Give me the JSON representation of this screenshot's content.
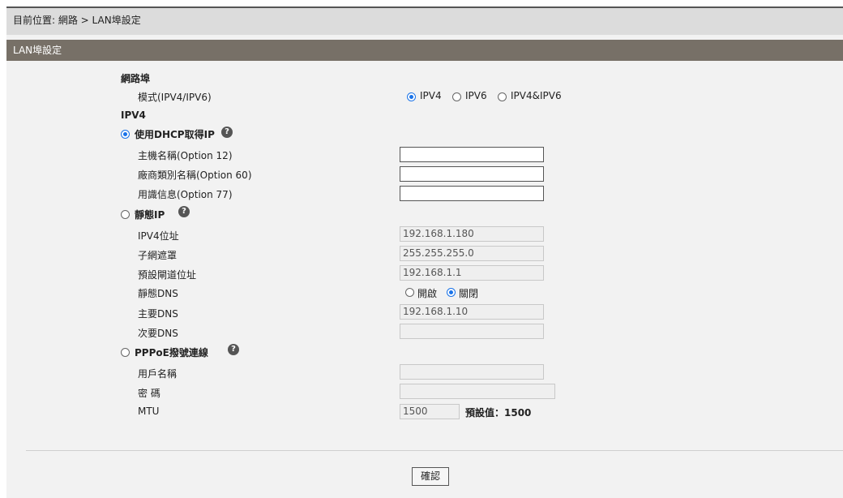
{
  "breadcrumb": "目前位置: 網路 > LAN埠設定",
  "panel": {
    "title": "LAN埠設定"
  },
  "form": {
    "section_port": "網路埠",
    "mode_label": "模式(IPV4/IPV6)",
    "mode_options": [
      "IPV4",
      "IPV6",
      "IPV4&IPV6"
    ],
    "mode_selected": "IPV4",
    "ipv4_heading": "IPV4",
    "dhcp": {
      "label": "使用DHCP取得IP",
      "selected": true,
      "fields": [
        {
          "label": "主機名稱(Option 12)",
          "value": ""
        },
        {
          "label": "廠商類別名稱(Option 60)",
          "value": ""
        },
        {
          "label": "用識信息(Option 77)",
          "value": ""
        }
      ]
    },
    "static": {
      "label": "靜態IP",
      "selected": false,
      "ipv4_label": "IPV4位址",
      "ipv4_value": "192.168.1.180",
      "mask_label": "子網遮罩",
      "mask_value": "255.255.255.0",
      "gateway_label": "預設閘道位址",
      "gateway_value": "192.168.1.1",
      "dns_label": "靜態DNS",
      "dns_options": [
        "開啟",
        "關閉"
      ],
      "dns_selected": "關閉",
      "primary_dns_label": "主要DNS",
      "primary_dns_value": "192.168.1.10",
      "secondary_dns_label": "次要DNS",
      "secondary_dns_value": ""
    },
    "pppoe": {
      "label": "PPPoE撥號連線",
      "selected": false,
      "user_label": "用戶名稱",
      "user_value": "",
      "password_label": "密 碼",
      "password_value": "",
      "mtu_label": "MTU",
      "mtu_value": "1500",
      "mtu_default_text": "預設值：1500"
    }
  },
  "confirm_label": "確認",
  "colors": {
    "title_bar": "#777067",
    "breadcrumb_bg": "#dcdcdc",
    "panel_bg": "#f2f2f2",
    "accent": "#1a73e8"
  },
  "icons": {
    "help": "question-circle-icon"
  }
}
